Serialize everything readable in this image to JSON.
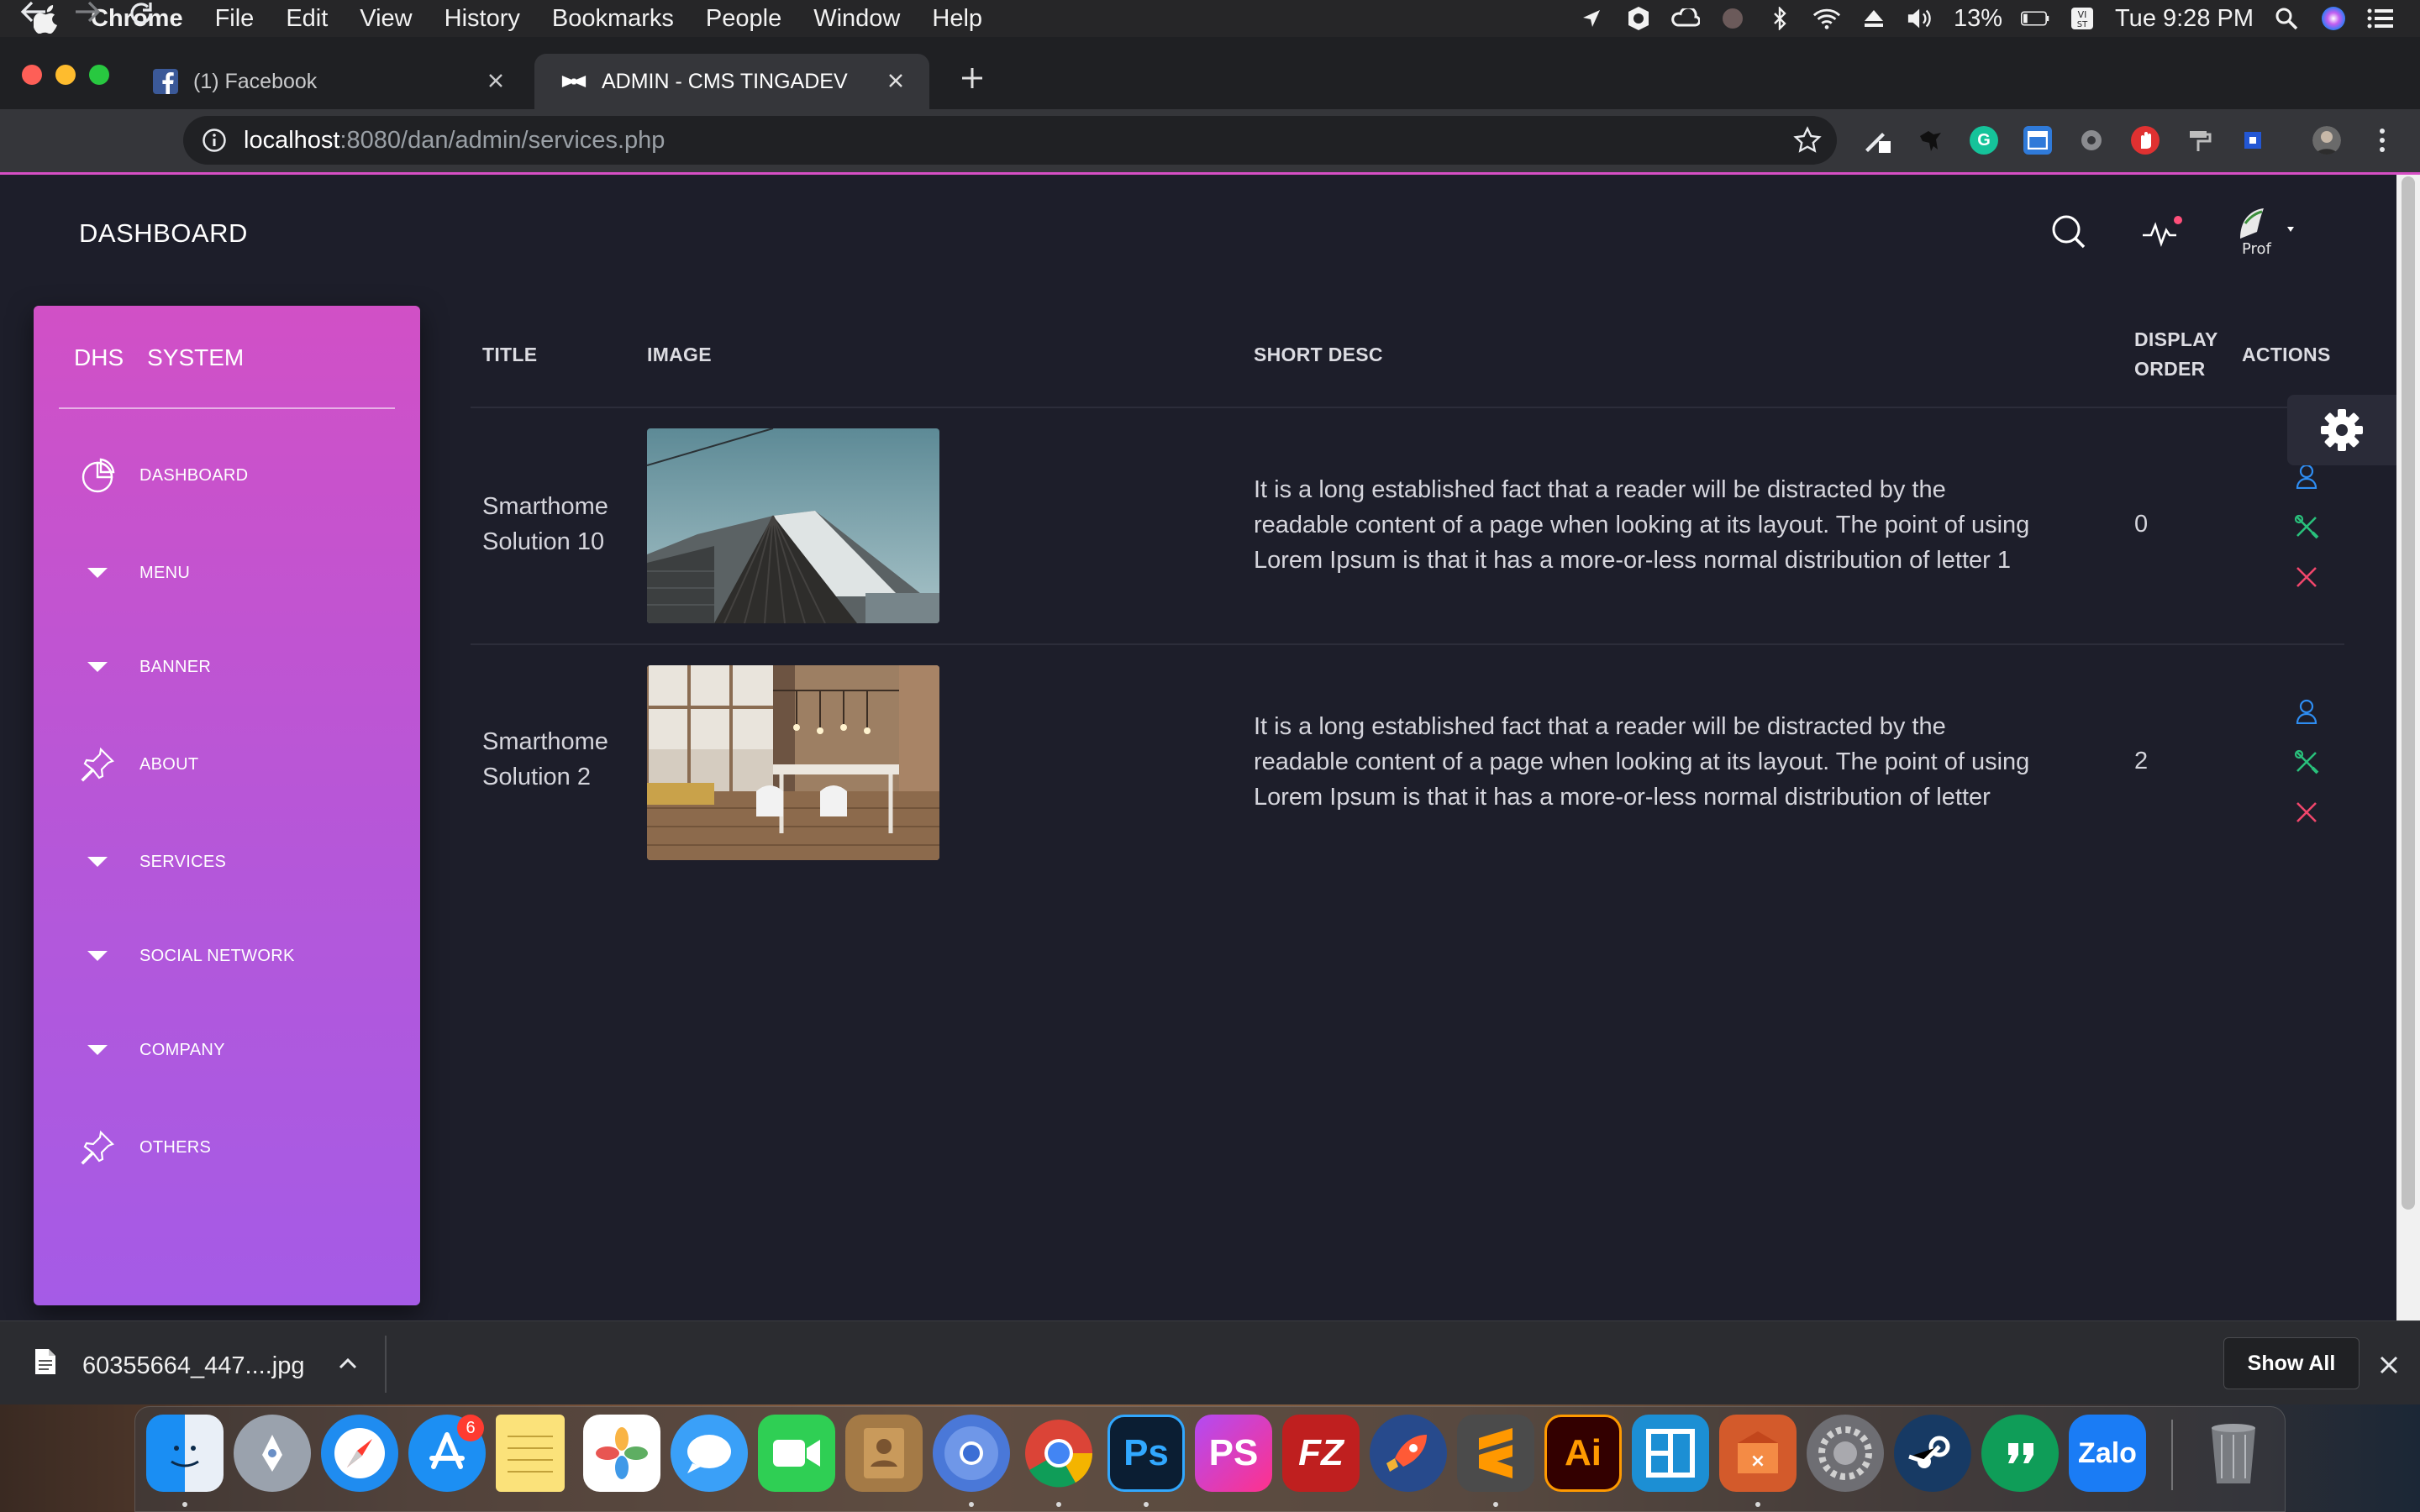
{
  "menubar": {
    "app_name": "Chrome",
    "menus": [
      "File",
      "Edit",
      "View",
      "History",
      "Bookmarks",
      "People",
      "Window",
      "Help"
    ],
    "battery": "13%",
    "clock": "Tue 9:28 PM"
  },
  "browser": {
    "tabs": [
      {
        "title": "(1) Facebook"
      },
      {
        "title": "ADMIN - CMS TINGADEV"
      }
    ],
    "url_host": "localhost",
    "url_path": ":8080/dan/admin/services.php"
  },
  "page": {
    "header_title": "DASHBOARD",
    "sidebar": {
      "brand_left": "DHS",
      "brand_right": "SYSTEM",
      "items": [
        {
          "label": "DASHBOARD",
          "icon": "pie-chart-icon"
        },
        {
          "label": "MENU",
          "icon": "caret-down-icon"
        },
        {
          "label": "BANNER",
          "icon": "caret-down-icon"
        },
        {
          "label": "ABOUT",
          "icon": "pin-icon"
        },
        {
          "label": "SERVICES",
          "icon": "caret-down-icon"
        },
        {
          "label": "SOCIAL NETWORK",
          "icon": "caret-down-icon"
        },
        {
          "label": "COMPANY",
          "icon": "caret-down-icon"
        },
        {
          "label": "OTHERS",
          "icon": "pin-icon"
        }
      ]
    },
    "table": {
      "headers": {
        "title": "TITLE",
        "image": "IMAGE",
        "short_desc": "SHORT DESC",
        "display_order_1": "DISPLAY",
        "display_order_2": "ORDER",
        "actions": "ACTIONS"
      },
      "rows": [
        {
          "title_line1": "Smarthome",
          "title_line2": "Solution 10",
          "desc_line1": "It is a long established fact that a reader will be distracted by the",
          "desc_line2": "readable content of a page when looking at its layout. The point of using",
          "desc_line3": "Lorem Ipsum is that it has a more-or-less normal distribution of letter 1",
          "display_order": "0"
        },
        {
          "title_line1": "Smarthome",
          "title_line2": "Solution 2",
          "desc_line1": "It is a long established fact that a reader will be distracted by the",
          "desc_line2": "readable content of a page when looking at its layout. The point of using",
          "desc_line3": "Lorem Ipsum is that it has a more-or-less normal distribution of letter",
          "display_order": "2"
        }
      ]
    }
  },
  "download_bar": {
    "file_name": "60355664_447....jpg",
    "show_all_label": "Show All"
  },
  "dock": {
    "app_store_badge": "6",
    "apps": [
      "Finder",
      "Launchpad",
      "Safari",
      "App Store",
      "Notes",
      "Photos",
      "Messages",
      "FaceTime",
      "Contacts",
      "Chromium",
      "Chrome",
      "Photoshop",
      "PhpStorm",
      "FileZilla",
      "Rocket",
      "Sublime Text",
      "Illustrator",
      "Screens",
      "XAMPP",
      "System Preferences",
      "Steam",
      "Hangouts",
      "Zalo",
      "Trash"
    ],
    "labels": {
      "photoshop": "Ps",
      "phpstorm": "PS",
      "filezilla": "FZ",
      "illustrator": "Ai",
      "zalo": "Zalo"
    }
  }
}
